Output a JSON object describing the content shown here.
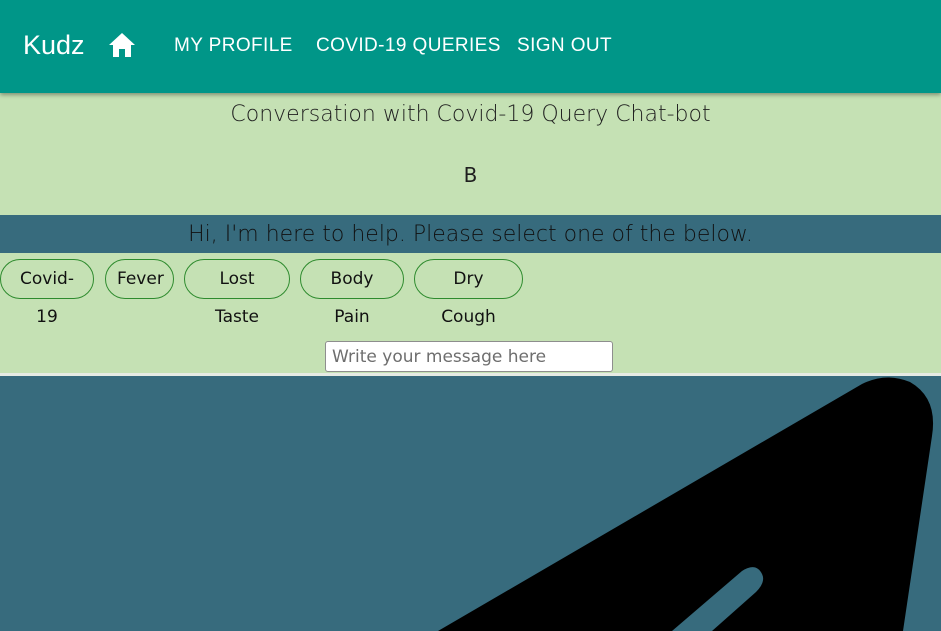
{
  "navbar": {
    "brand": "Kudz",
    "home_icon": "home-icon",
    "links": [
      "MY PROFILE",
      "COVID-19 QUERIES",
      "SIGN OUT"
    ]
  },
  "chat": {
    "title": "Conversation with Covid-19 Query Chat-bot",
    "avatar_letter": "B",
    "bot_message": "Hi, I'm here to help. Please select one of the below.",
    "options": [
      "Covid-19",
      "Fever",
      "Lost Taste",
      "Body Pain",
      "Dry Cough"
    ],
    "input_placeholder": "Write your message here",
    "send_icon": "send-icon"
  },
  "colors": {
    "navbar": "#009688",
    "page_background": "#c5e1b4",
    "message_band": "#376b7d",
    "option_border": "#2e8b2e"
  }
}
